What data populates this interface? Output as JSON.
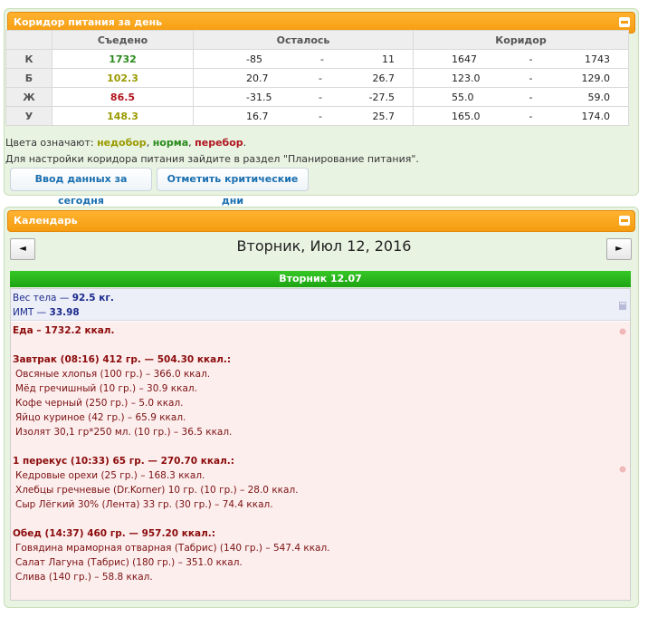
{
  "corridor": {
    "header": "Коридор питания за день",
    "columns": [
      "Съедено",
      "Осталось",
      "Коридор"
    ],
    "rows": [
      {
        "label": "К",
        "eaten": "1732",
        "eaten_status": "norm",
        "left_min": "-85",
        "sep": "-",
        "left_max": "11",
        "cor_min": "1647",
        "cor_max": "1743"
      },
      {
        "label": "Б",
        "eaten": "102.3",
        "eaten_status": "under",
        "left_min": "20.7",
        "sep": "-",
        "left_max": "26.7",
        "cor_min": "123.0",
        "cor_max": "129.0"
      },
      {
        "label": "Ж",
        "eaten": "86.5",
        "eaten_status": "over",
        "left_min": "-31.5",
        "sep": "-",
        "left_max": "-27.5",
        "cor_min": "55.0",
        "cor_max": "59.0"
      },
      {
        "label": "У",
        "eaten": "148.3",
        "eaten_status": "under",
        "left_min": "16.7",
        "sep": "-",
        "left_max": "25.7",
        "cor_min": "165.0",
        "cor_max": "174.0"
      }
    ],
    "legend_prefix": "Цвета означают:",
    "legend_under": "недобор",
    "legend_norm": "норма",
    "legend_over": "перебор",
    "comma": ",",
    "period": ".",
    "settings_note": "Для настройки коридора питания зайдите в раздел \"Планирование питания\".",
    "btn_enter": "Ввод данных за сегодня",
    "btn_critical": "Отметить критические дни"
  },
  "calendar": {
    "header": "Календарь",
    "prev": "◄",
    "next": "►",
    "date_title": "Вторник, Июл 12, 2016",
    "day_label": "Вторник 12.07",
    "weight_label": "Вес тела",
    "weight_value": "92.5 кг.",
    "bmi_label": "ИМТ",
    "bmi_value": "33.98",
    "dash": "—",
    "food_total": "Еда – 1732.2 ккал.",
    "meals": [
      {
        "title": "Завтрак (08:16) 412 гр. — 504.30 ккал.:",
        "items": [
          "Овсяные хлопья (100 гр.) – 366.0 ккал.",
          "Мёд гречишный (10 гр.) – 30.9 ккал.",
          "Кофе черный (250 гр.) – 5.0 ккал.",
          "Яйцо куриное (42 гр.) – 65.9 ккал.",
          "Изолят 30,1 гр*250 мл. (10 гр.) – 36.5 ккал."
        ]
      },
      {
        "title": "1 перекус (10:33) 65 гр. — 270.70 ккал.:",
        "items": [
          "Кедровые орехи (25 гр.) – 168.3 ккал.",
          "Хлебцы гречневые (Dr.Korner) 10 гр. (10 гр.) – 28.0 ккал.",
          "Сыр Лёгкий 30% (Лента) 33 гр. (30 гр.) – 74.4 ккал."
        ]
      },
      {
        "title": "Обед (14:37) 460 гр. — 957.20 ккал.:",
        "items": [
          "Говядина мраморная отварная (Табрис) (140 гр.) – 547.4 ккал.",
          "Салат Лагуна (Табрис) (180 гр.) – 351.0 ккал.",
          "Слива (140 гр.) – 58.8 ккал."
        ]
      }
    ]
  },
  "colors": {
    "accent_orange": "#f59c10",
    "green_bar": "#1ea314",
    "norm": "#2a8a1c",
    "under": "#9a9a00",
    "over": "#b0151f"
  }
}
